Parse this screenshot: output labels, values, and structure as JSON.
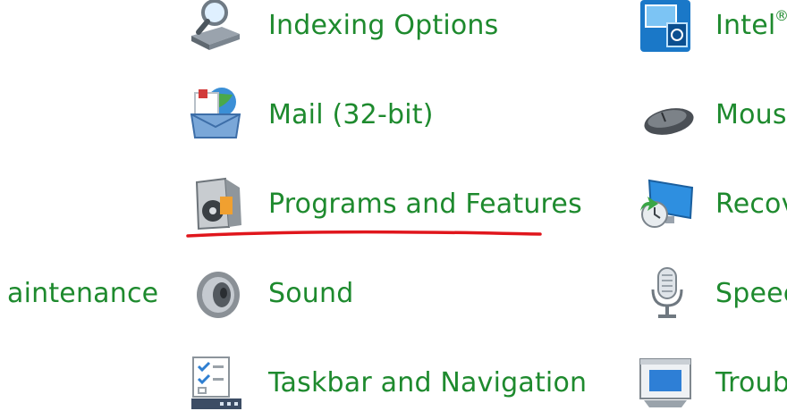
{
  "col_left": {
    "items": [
      {
        "label": "aintenance"
      }
    ]
  },
  "col_middle": {
    "items": [
      {
        "label": "Indexing Options",
        "icon": "indexing-options-icon"
      },
      {
        "label": "Mail (32-bit)",
        "icon": "mail-icon"
      },
      {
        "label": "Programs and Features",
        "icon": "programs-features-icon"
      },
      {
        "label": "Sound",
        "icon": "speaker-icon"
      },
      {
        "label": "Taskbar and Navigation",
        "icon": "taskbar-icon"
      }
    ]
  },
  "col_right": {
    "items": [
      {
        "label": "Intel",
        "icon": "intel-graphics-icon"
      },
      {
        "label": "Mous",
        "icon": "mouse-icon"
      },
      {
        "label": "Recov",
        "icon": "recovery-icon"
      },
      {
        "label": "Speec",
        "icon": "microphone-icon"
      },
      {
        "label": "Troub",
        "icon": "troubleshooting-icon"
      }
    ]
  },
  "colors": {
    "link": "#1e8a2e",
    "annotation": "#e0161c"
  }
}
